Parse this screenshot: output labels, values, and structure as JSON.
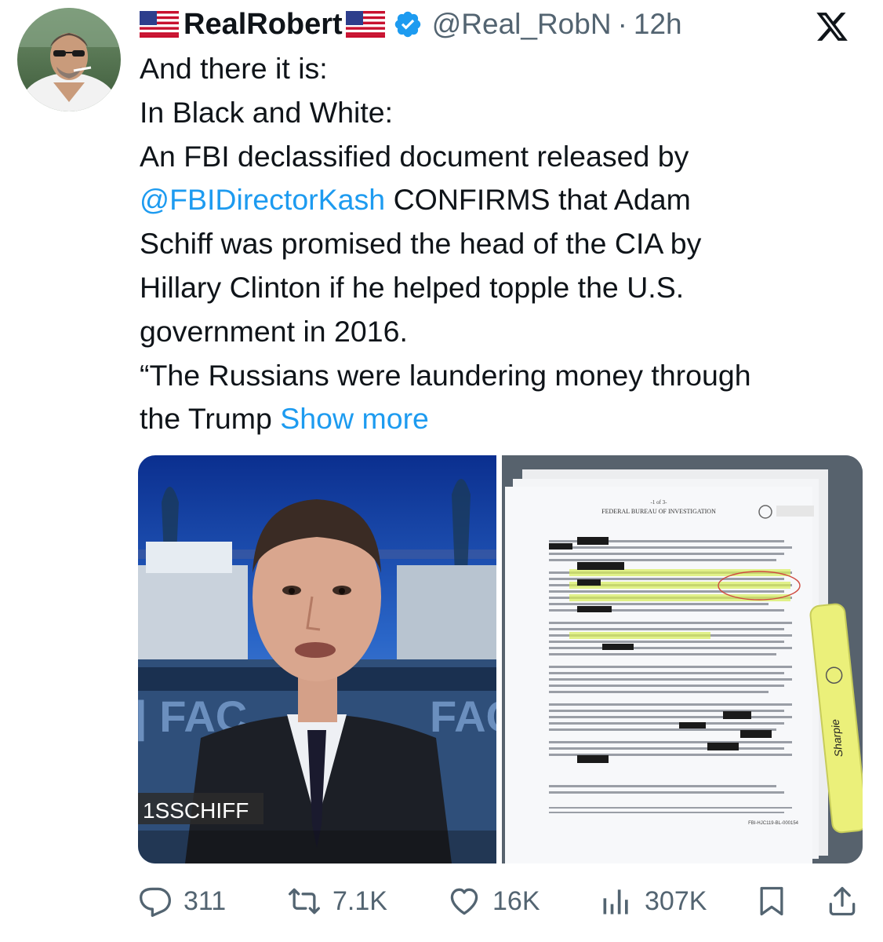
{
  "tweet": {
    "author": {
      "display_name": "RealRobert",
      "handle": "@Real_RobN",
      "time": "12h",
      "verified": true
    },
    "text_lines": [
      "And there it is:",
      "In Black and White:",
      "An FBI declassified document released by"
    ],
    "mention": "@FBIDirectorKash",
    "line4_rest": " CONFIRMS that Adam",
    "text_lines_2": [
      "Schiff was promised the head of the CIA by",
      "Hillary Clinton if he helped topple the U.S.",
      "government in 2016.",
      "“The Russians were laundering money through"
    ],
    "last_line": "the Trump ",
    "show_more": "Show more"
  },
  "media": {
    "left": {
      "chyron": "1SSCHIFF"
    },
    "right": {
      "doc_header": "FEDERAL BUREAU OF INVESTIGATION",
      "doc_page": "-1 of 3-",
      "doc_footer_id": "FBI-HJC119-BL-000154",
      "highlighter_brand": "Sharpie"
    }
  },
  "actions": {
    "replies": "311",
    "reposts": "7.1K",
    "likes": "16K",
    "views": "307K"
  },
  "colors": {
    "link": "#1d9bf0",
    "secondary_text": "#536471",
    "verified_badge": "#1d9bf0"
  },
  "icons": [
    "us-flag-icon",
    "verified-badge-icon",
    "x-logo-icon",
    "reply-icon",
    "repost-icon",
    "like-icon",
    "views-icon",
    "bookmark-icon",
    "share-icon"
  ]
}
